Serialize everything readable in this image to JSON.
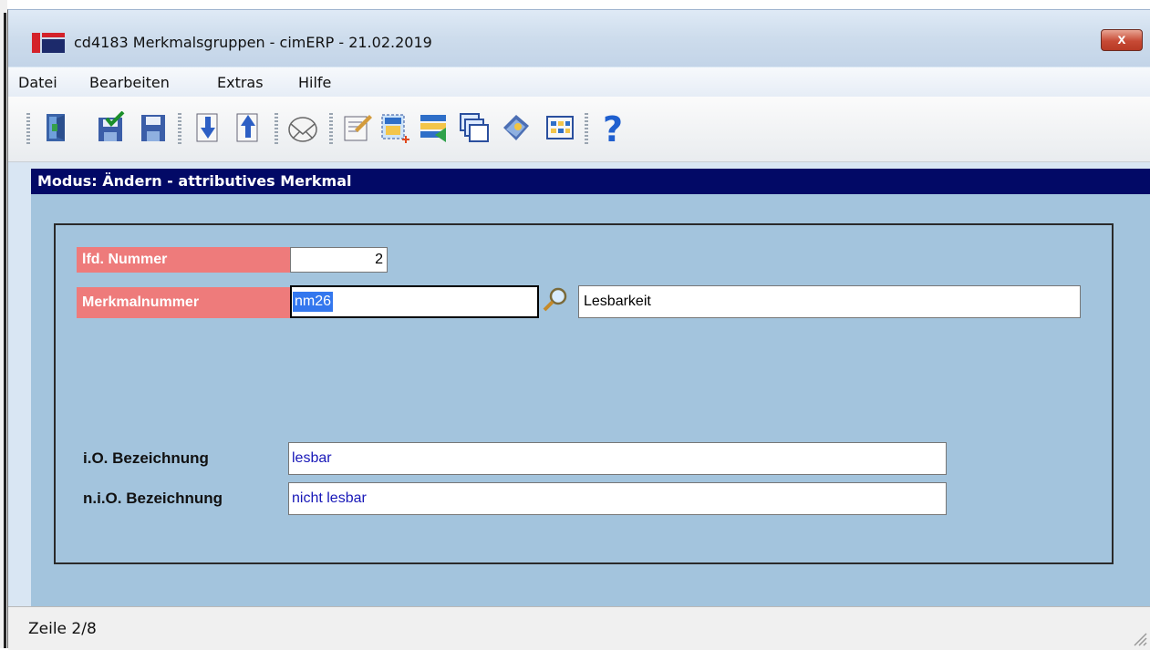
{
  "window": {
    "title": "cd4183 Merkmalsgruppen - cimERP - 21.02.2019",
    "close_label": "x"
  },
  "menu": [
    "Datei",
    "Bearbeiten",
    "Extras",
    "Hilfe"
  ],
  "toolbar_icons": [
    "exit-icon",
    "save-icon",
    "save-disk-icon",
    "record-down-icon",
    "record-up-icon",
    "mail-icon",
    "edit-note-icon",
    "new-record-icon",
    "list-transfer-icon",
    "windows-icon",
    "book-icon",
    "grid-icon",
    "help-icon"
  ],
  "mode_text": "Modus: Ändern - attributives Merkmal",
  "form": {
    "lfd_label": "lfd. Nummer",
    "lfd_value": "2",
    "merkmal_label": "Merkmalnummer",
    "merkmal_value": "nm26",
    "merkmal_desc": "Lesbarkeit",
    "io_label": "i.O. Bezeichnung",
    "io_value": "lesbar",
    "nio_label": "n.i.O. Bezeichnung",
    "nio_value": "nicht lesbar"
  },
  "status": "Zeile 2/8",
  "colors": {
    "mode_bar": "#020966",
    "content_bg": "#a3c4dd",
    "label_pink": "#ee7b7b",
    "field_text_blue": "#1818b8",
    "close_red": "#c74a35"
  }
}
